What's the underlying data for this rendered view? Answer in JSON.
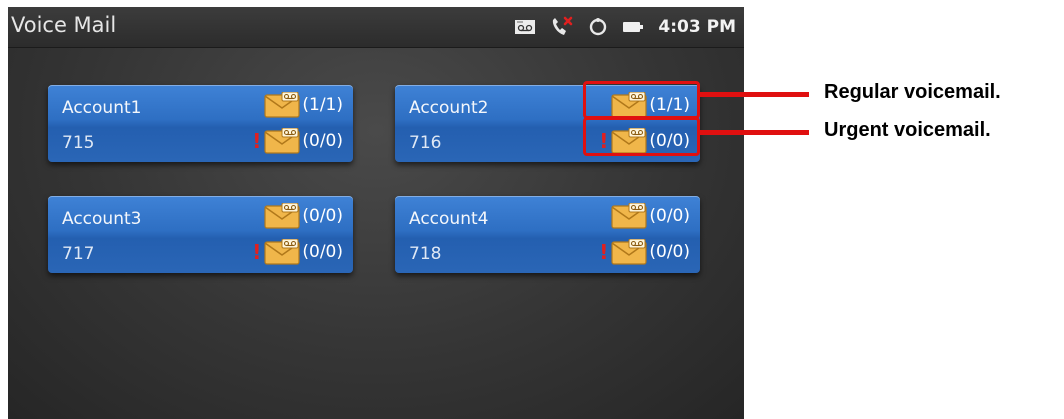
{
  "status_bar": {
    "title": "Voice Mail",
    "time": "4:03 PM",
    "icons": [
      "voicemail-icon",
      "missed-call-icon",
      "sync-icon",
      "battery-icon"
    ]
  },
  "accounts": [
    {
      "name": "Account1",
      "number": "715",
      "regular": "(1/1)",
      "urgent": "(0/0)"
    },
    {
      "name": "Account2",
      "number": "716",
      "regular": "(1/1)",
      "urgent": "(0/0)"
    },
    {
      "name": "Account3",
      "number": "717",
      "regular": "(0/0)",
      "urgent": "(0/0)"
    },
    {
      "name": "Account4",
      "number": "718",
      "regular": "(0/0)",
      "urgent": "(0/0)"
    }
  ],
  "annotations": {
    "regular": "Regular voicemail.",
    "urgent": "Urgent voicemail."
  },
  "urgent_mark": "!",
  "colors": {
    "accent": "#2e6fc3",
    "callout": "#e01010",
    "urgent": "#e02020"
  }
}
